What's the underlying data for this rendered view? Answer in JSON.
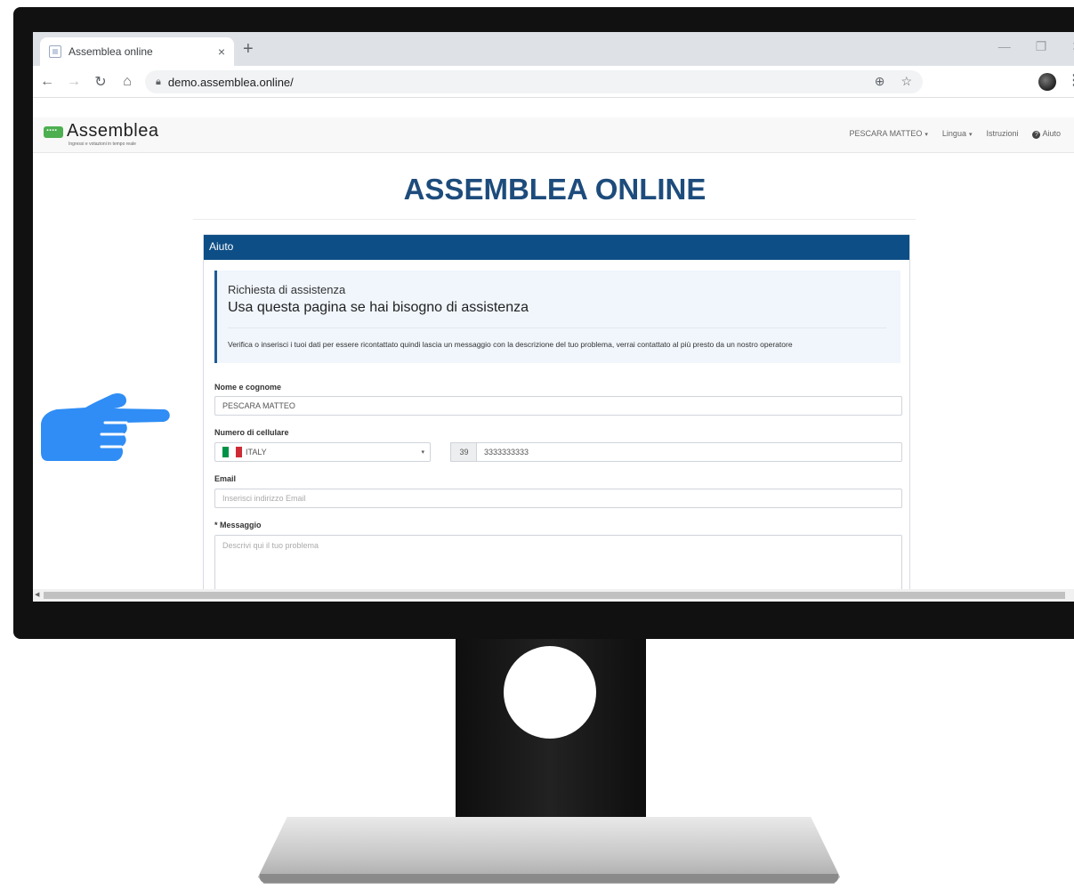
{
  "browser": {
    "tab_title": "Assemblea online",
    "tab_close": "×",
    "new_tab": "+",
    "url": "demo.assemblea.online/",
    "window_controls": [
      "—",
      "❐",
      "✕"
    ]
  },
  "site": {
    "logo_text": "Assemblea",
    "logo_tagline": "Ingressi e votazioni in tempo reale",
    "menu": {
      "user": "PESCARA MATTEO",
      "language": "Lingua",
      "instructions": "Istruzioni",
      "help": "Aiuto"
    },
    "page_title": "ASSEMBLEA ONLINE"
  },
  "help_panel": {
    "heading": "Aiuto",
    "info_small": "Richiesta di assistenza",
    "info_large": "Usa questa pagina se hai bisogno di assistenza",
    "info_description": "Verifica o inserisci i tuoi dati per essere ricontattato quindi lascia un messaggio con la descrizione del tuo problema, verrai contattato al più presto da un nostro operatore"
  },
  "form": {
    "name_label": "Nome e cognome",
    "name_value": "PESCARA MATTEO",
    "phone_label": "Numero di cellulare",
    "country_value": "ITALY",
    "phone_prefix": "39",
    "phone_value": "3333333333",
    "email_label": "Email",
    "email_placeholder": "Inserisci indirizzo Email",
    "message_label": "* Messaggio",
    "message_placeholder": "Descrivi qui il tuo problema"
  },
  "colors": {
    "brand_blue": "#0d4e86",
    "title_blue": "#1d4c7c",
    "logo_green": "#4caf50",
    "hand_blue": "#2f8df5"
  },
  "icons": {
    "pointer": "pointing-hand-icon",
    "flag": "italy-flag-icon"
  }
}
